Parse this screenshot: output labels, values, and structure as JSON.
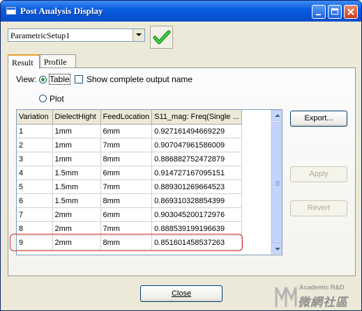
{
  "window": {
    "title": "Post Analysis Display"
  },
  "setup": {
    "selected": "ParametricSetup1"
  },
  "tabs": [
    {
      "label": "Result"
    },
    {
      "label": "Profile"
    }
  ],
  "view": {
    "label": "View:",
    "table_label": "Table",
    "plot_label": "Plot",
    "show_complete_label": "Show complete output name",
    "selected": "Table",
    "show_complete_checked": false
  },
  "table": {
    "columns": [
      "Variation",
      "DielectHight",
      "FeedLocation",
      "S11_mag: Freq(Single ..."
    ],
    "rows": [
      [
        "1",
        "1mm",
        "6mm",
        "0.927161494669229"
      ],
      [
        "2",
        "1mm",
        "7mm",
        "0.907047961586009"
      ],
      [
        "3",
        "1mm",
        "8mm",
        "0.886882752472879"
      ],
      [
        "4",
        "1.5mm",
        "6mm",
        "0.914727167095151"
      ],
      [
        "5",
        "1.5mm",
        "7mm",
        "0.889301269664523"
      ],
      [
        "6",
        "1.5mm",
        "8mm",
        "0.869310328854399"
      ],
      [
        "7",
        "2mm",
        "6mm",
        "0.903045200172976"
      ],
      [
        "8",
        "2mm",
        "7mm",
        "0.888539199196639"
      ],
      [
        "9",
        "2mm",
        "8mm",
        "0.851601458537263"
      ]
    ],
    "highlighted_row": 9
  },
  "buttons": {
    "export": "Export...",
    "apply": "Apply",
    "revert": "Revert",
    "close": "Close"
  },
  "watermark": {
    "line1": "Academic R&D",
    "line2": "微網社區"
  },
  "colors": {
    "title_bar": "#0a5ee0",
    "highlight": "#d02a2a",
    "check": "#2fb52f"
  }
}
